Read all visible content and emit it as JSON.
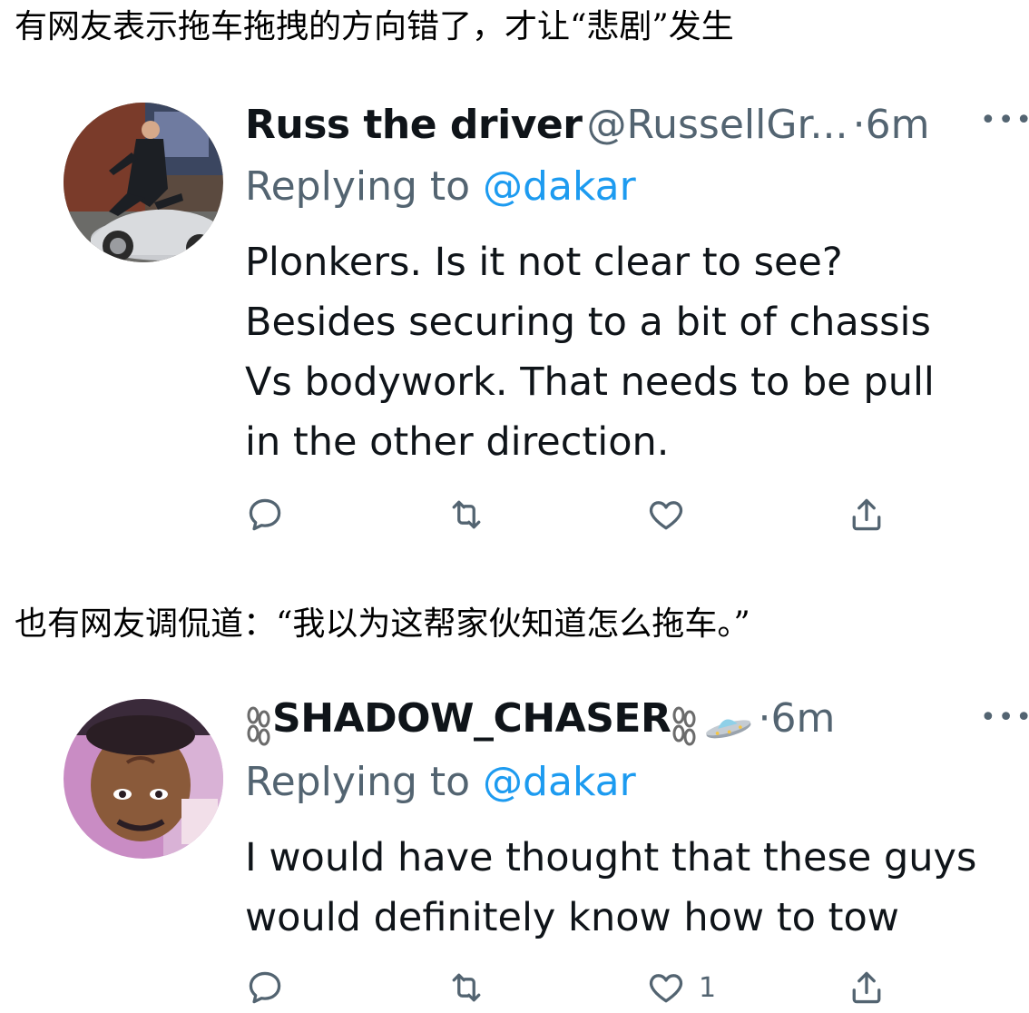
{
  "captions": {
    "first": "有网友表示拖车拖拽的方向错了，才让“悲剧”发生",
    "second": "也有网友调侃道：“我以为这帮家伙知道怎么拖车。”"
  },
  "tweets": [
    {
      "display_name": "Russ the driver",
      "handle": "@RussellGr...",
      "separator": "·",
      "time": "6m",
      "replying_prefix": "Replying to ",
      "replying_to": "@dakar",
      "body_lines": [
        "Plonkers. Is it not clear to see?",
        "Besides securing to a bit of chassis",
        "Vs bodywork. That needs to be pull",
        "in the other direction."
      ],
      "like_count": "",
      "avatar_icon": "man-jumping-over-silver-car-photo"
    },
    {
      "display_name": "SHADOW_CHASER",
      "name_decorations": [
        "chain-emoji",
        "chain-emoji",
        "ufo-emoji"
      ],
      "separator": "·",
      "time": "6m",
      "replying_prefix": "Replying to ",
      "replying_to": "@dakar",
      "body_lines": [
        "I would have thought that these guys",
        "would definitely know how to tow"
      ],
      "like_count": "1",
      "avatar_icon": "person-selfie-photo"
    }
  ],
  "icons": {
    "reply": "speech-bubble-icon",
    "retweet": "retweet-arrows-icon",
    "like": "heart-icon",
    "share": "share-upload-icon",
    "more": "more-dots-icon"
  },
  "colors": {
    "text": "#0f1419",
    "muted": "#536471",
    "mention": "#1d9bf0",
    "background": "#ffffff"
  }
}
